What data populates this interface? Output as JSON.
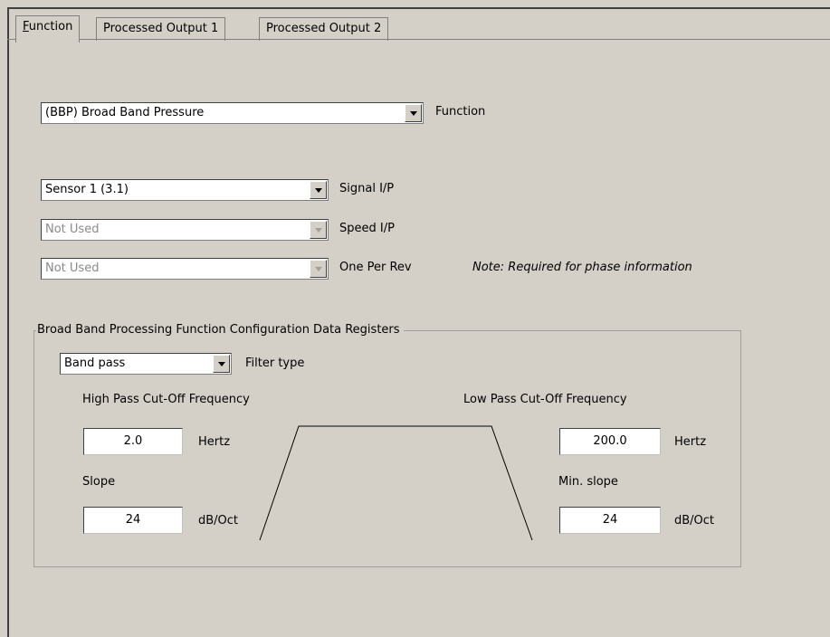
{
  "tabs": [
    {
      "label_prefix": "",
      "label_underline": "F",
      "label_rest": "unction"
    },
    {
      "label": "Processed Output 1"
    },
    {
      "label": "Processed Output 2"
    }
  ],
  "function": {
    "value": "(BBP) Broad Band Pressure",
    "label": "Function"
  },
  "signal": {
    "value": "Sensor 1 (3.1)",
    "label": "Signal I/P"
  },
  "speed": {
    "value": "Not Used",
    "label": "Speed I/P"
  },
  "one_per_rev": {
    "value": "Not Used",
    "label": "One Per Rev",
    "note": "Note: Required for phase information"
  },
  "group": {
    "title": "Broad Band Processing Function Configuration Data Registers",
    "filter": {
      "value": "Band pass",
      "label": "Filter type"
    },
    "high_pass": {
      "title": "High Pass Cut-Off Frequency",
      "freq_value": "2.0",
      "freq_unit": "Hertz",
      "slope_label": "Slope",
      "slope_value": "24",
      "slope_unit": "dB/Oct"
    },
    "low_pass": {
      "title": "Low Pass Cut-Off Frequency",
      "freq_value": "200.0",
      "freq_unit": "Hertz",
      "slope_label": "Min. slope",
      "slope_value": "24",
      "slope_unit": "dB/Oct"
    }
  }
}
